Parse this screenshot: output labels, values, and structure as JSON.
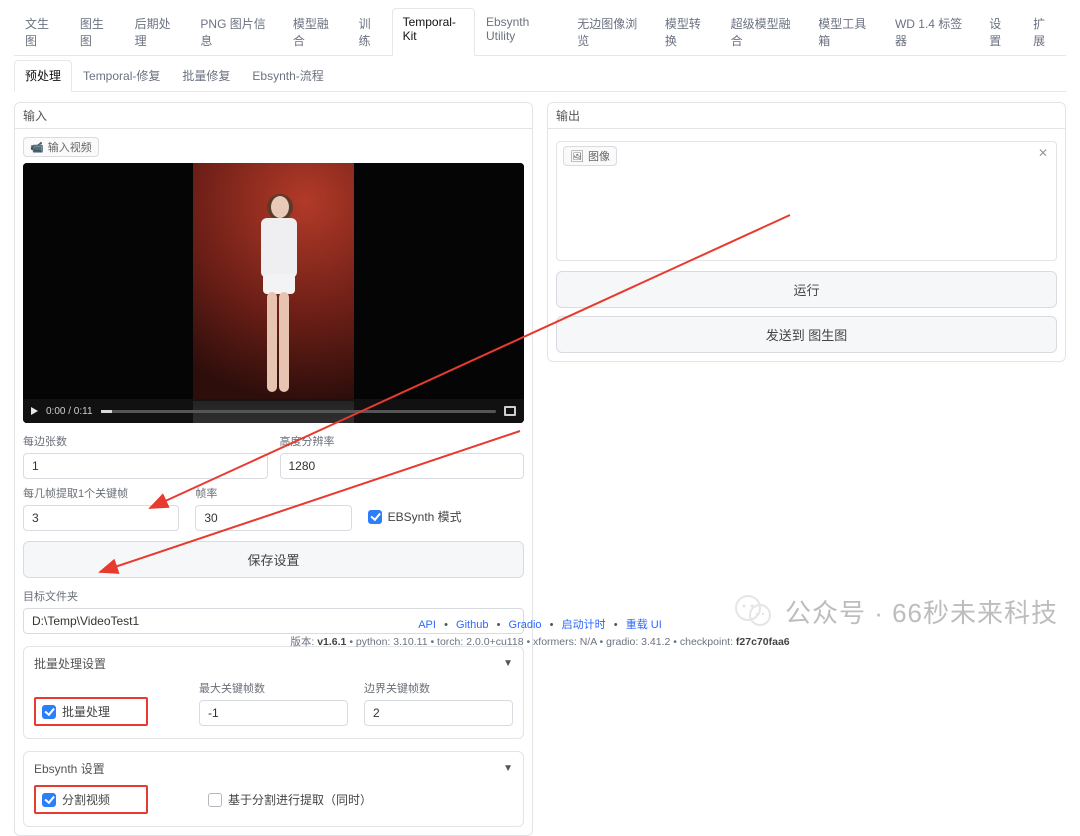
{
  "top_tabs": [
    "文生图",
    "图生图",
    "后期处理",
    "PNG 图片信息",
    "模型融合",
    "训练",
    "Temporal-Kit",
    "Ebsynth Utility",
    "无边图像浏览",
    "模型转换",
    "超级模型融合",
    "模型工具箱",
    "WD 1.4 标签器",
    "设置",
    "扩展"
  ],
  "top_active_index": 6,
  "sub_tabs": [
    "预处理",
    "Temporal-修复",
    "批量修复",
    "Ebsynth-流程"
  ],
  "sub_active_index": 0,
  "left": {
    "panel_title": "输入",
    "upload_tag": "输入视频",
    "video": {
      "time": "0:00  /  0:11"
    },
    "param_per_side": {
      "label": "每边张数",
      "value": "1"
    },
    "param_height_res": {
      "label": "高度分辨率",
      "value": "1280"
    },
    "param_keyframe_every": {
      "label": "每几帧提取1个关键帧",
      "value": "3"
    },
    "param_fps": {
      "label": "帧率",
      "value": "30"
    },
    "ck_ebsynth_mode": "EBSynth 模式",
    "btn_save": "保存设置",
    "target_folder": {
      "label": "目标文件夹",
      "value": "D:\\Temp\\VideoTest1"
    },
    "batch_section": {
      "title": "批量处理设置",
      "ck_batch": "批量处理",
      "max_key": {
        "label": "最大关键帧数",
        "value": "-1"
      },
      "border_key": {
        "label": "边界关键帧数",
        "value": "2"
      }
    },
    "ebsynth_section": {
      "title": "Ebsynth 设置",
      "ck_split": "分割视频",
      "ck_split_extract": "基于分割进行提取（同时）"
    }
  },
  "right": {
    "panel_title": "输出",
    "out_tag": "图像",
    "btn_run": "运行",
    "btn_send": "发送到 图生图"
  },
  "footer": {
    "links": [
      "API",
      "Github",
      "Gradio",
      "启动计时",
      "重载 UI"
    ],
    "line2_prefix": "版本:",
    "line2_version": "v1.6.1",
    "line2_rest": " •  python: 3.10.11  •  torch: 2.0.0+cu118  •  xformers: N/A  •  gradio: 3.41.2  •  checkpoint: ",
    "line2_ckpt": "f27c70faa6"
  },
  "watermark": "公众号 · 66秒未来科技"
}
